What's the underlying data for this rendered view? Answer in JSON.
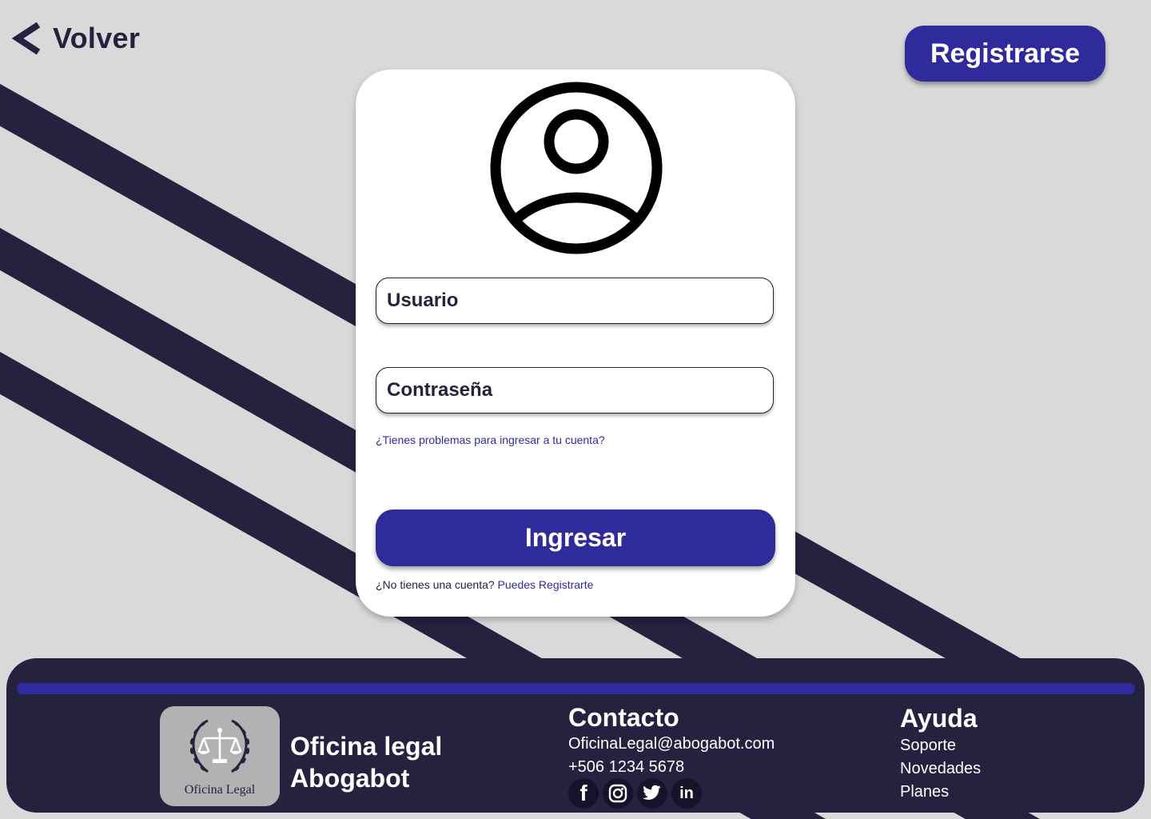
{
  "nav": {
    "back_label": "Volver",
    "register_label": "Registrarse"
  },
  "login": {
    "username_placeholder": "Usuario",
    "password_placeholder": "Contraseña",
    "trouble_link": "¿Tienes problemas para ingresar a tu cuenta?",
    "submit_label": "Ingresar",
    "no_account_text": "¿No tienes una cuenta?",
    "signup_link": "Puedes Registrarte"
  },
  "footer": {
    "logo_text": "Oficina Legal",
    "brand_line1": "Oficina legal",
    "brand_line2": "Abogabot",
    "contact": {
      "title": "Contacto",
      "email": "OficinaLegal@abogabot.com",
      "phone": "+506 1234 5678",
      "socials": [
        {
          "icon": "facebook-icon",
          "glyph": "f"
        },
        {
          "icon": "instagram-icon",
          "glyph": ""
        },
        {
          "icon": "twitter-icon",
          "glyph": ""
        },
        {
          "icon": "linkedin-icon",
          "glyph": "in"
        }
      ]
    },
    "help": {
      "title": "Ayuda",
      "items": [
        "Soporte",
        "Novedades",
        "Planes"
      ]
    }
  },
  "colors": {
    "background": "#d9d9d9",
    "navy": "#24223f",
    "primary": "#302b9c",
    "card": "#ffffff"
  }
}
